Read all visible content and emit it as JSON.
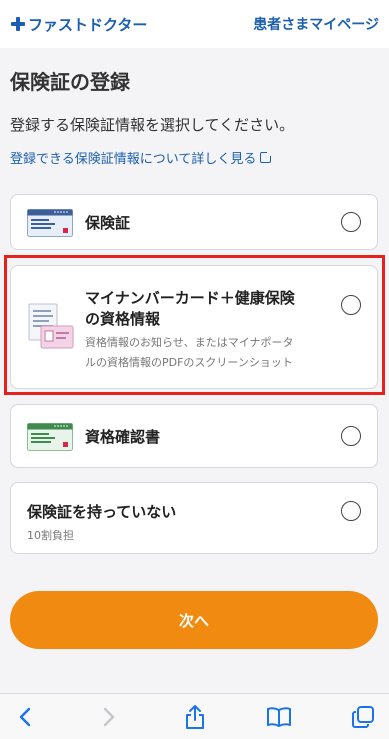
{
  "header": {
    "brand": "ファストドクター",
    "mypage": "患者さまマイページ"
  },
  "page": {
    "title": "保険証の登録",
    "description": "登録する保険証情報を選択してください。",
    "learn_more": "登録できる保険証情報について詳しく見る"
  },
  "options": [
    {
      "label": "保険証"
    },
    {
      "label_line1": "マイナンバーカード＋健康保険",
      "label_line2": "の資格情報",
      "sub_line1": "資格情報のお知らせ、またはマイナポータ",
      "sub_line2": "ルの資格情報のPDFのスクリーンショット"
    },
    {
      "label": "資格確認書"
    },
    {
      "label": "保険証を持っていない",
      "sub": "10割負担"
    }
  ],
  "next_button": "次へ",
  "colors": {
    "brand_blue": "#1b5fb0",
    "next_orange": "#f08a11",
    "highlight_red": "#e3231c"
  },
  "toolbar_icons": [
    "back-icon",
    "forward-icon",
    "share-icon",
    "bookmarks-icon",
    "tabs-icon"
  ]
}
